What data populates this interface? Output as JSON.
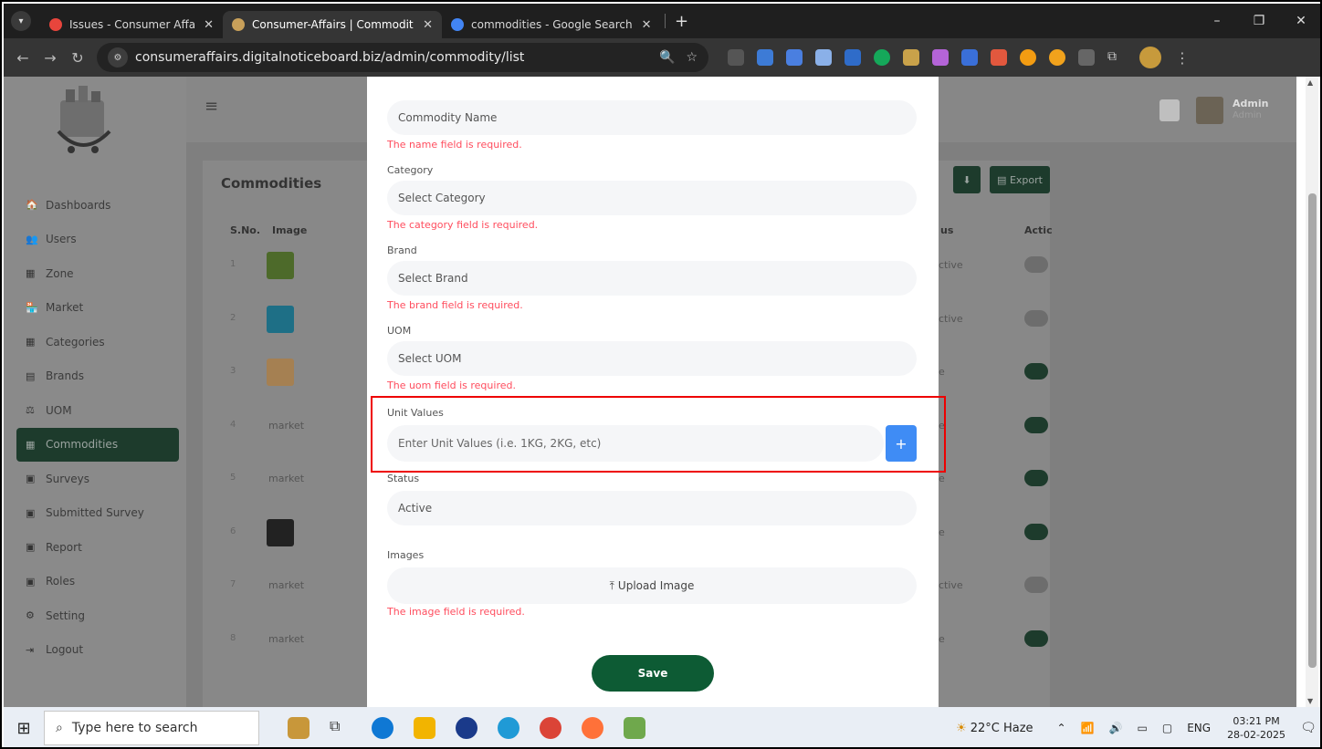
{
  "browser": {
    "tabs": [
      {
        "title": "Issues - Consumer Affairs Admi",
        "favicon_color": "#e8453c",
        "active": false
      },
      {
        "title": "Consumer-Affairs | Commodity",
        "favicon_color": "#c8a05a",
        "active": true
      },
      {
        "title": "commodities - Google Search",
        "favicon_color": "#4285f4",
        "active": false
      }
    ],
    "new_tab": "+",
    "url": "consumeraffairs.digitalnoticeboard.biz/admin/commodity/list",
    "window_controls": [
      "–",
      "❐",
      "✕"
    ]
  },
  "sidebar": {
    "items": [
      {
        "label": "Dashboards",
        "icon": "🏠",
        "active": false
      },
      {
        "label": "Users",
        "icon": "👥",
        "active": false
      },
      {
        "label": "Zone",
        "icon": "▦",
        "active": false
      },
      {
        "label": "Market",
        "icon": "🏪",
        "active": false
      },
      {
        "label": "Categories",
        "icon": "▦",
        "active": false
      },
      {
        "label": "Brands",
        "icon": "▤",
        "active": false
      },
      {
        "label": "UOM",
        "icon": "⚖",
        "active": false
      },
      {
        "label": "Commodities",
        "icon": "▦",
        "active": true
      },
      {
        "label": "Surveys",
        "icon": "▣",
        "active": false
      },
      {
        "label": "Submitted Survey",
        "icon": "▣",
        "active": false
      },
      {
        "label": "Report",
        "icon": "▣",
        "active": false
      },
      {
        "label": "Roles",
        "icon": "▣",
        "active": false
      },
      {
        "label": "Setting",
        "icon": "⚙",
        "active": false
      },
      {
        "label": "Logout",
        "icon": "⇥",
        "active": false
      }
    ]
  },
  "header": {
    "menu_icon": "≡",
    "user_name": "Admin",
    "user_role": "Admin"
  },
  "list": {
    "title": "Commodities",
    "columns": [
      "S.No.",
      "Image",
      "us",
      "Actic"
    ],
    "export_label": "Export",
    "broken_image_alt": "market",
    "rows": [
      {
        "sno": "1",
        "status": "ctive",
        "toggle_on": false,
        "img_color": "#4d6a2a",
        "img": true
      },
      {
        "sno": "2",
        "status": "ctive",
        "toggle_on": false,
        "img_color": "#1e6f86",
        "img": true
      },
      {
        "sno": "3",
        "status": "e",
        "toggle_on": true,
        "img_color": "#a58052",
        "img": true
      },
      {
        "sno": "4",
        "status": "e",
        "toggle_on": true,
        "img": false
      },
      {
        "sno": "5",
        "status": "e",
        "toggle_on": true,
        "img": false
      },
      {
        "sno": "6",
        "status": "e",
        "toggle_on": true,
        "img_color": "#222",
        "img": true
      },
      {
        "sno": "7",
        "status": "ctive",
        "toggle_on": false,
        "img": false
      },
      {
        "sno": "8",
        "status": "e",
        "toggle_on": true,
        "img": false
      }
    ]
  },
  "modal": {
    "name_placeholder": "Commodity Name",
    "name_error": "The name field is required.",
    "category_label": "Category",
    "category_placeholder": "Select Category",
    "category_error": "The category field is required.",
    "brand_label": "Brand",
    "brand_placeholder": "Select Brand",
    "brand_error": "The brand field is required.",
    "uom_label": "UOM",
    "uom_placeholder": "Select UOM",
    "uom_error": "The uom field is required.",
    "unit_label": "Unit Values",
    "unit_placeholder": "Enter Unit Values (i.e. 1KG, 2KG, etc)",
    "add_label": "+",
    "status_label": "Status",
    "status_value": "Active",
    "images_label": "Images",
    "upload_label": "Upload Image",
    "image_error": "The image field is required.",
    "save_label": "Save"
  },
  "taskbar": {
    "search_placeholder": "Type here to search",
    "weather": "22°C  Haze",
    "lang": "ENG",
    "time": "03:21 PM",
    "date": "28-02-2025"
  }
}
